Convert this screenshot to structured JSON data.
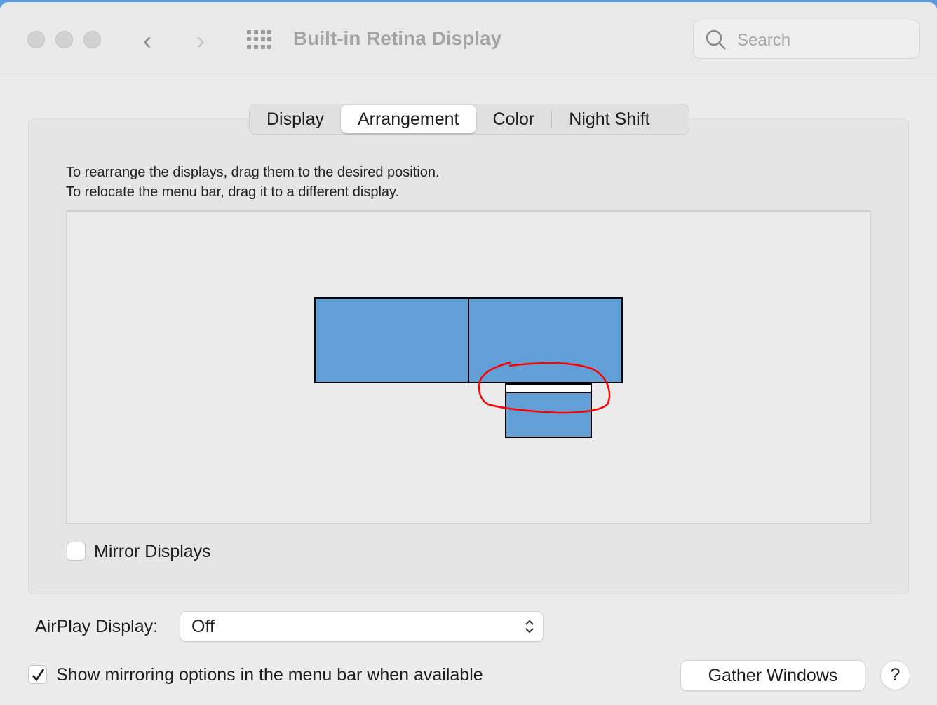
{
  "window": {
    "title": "Built-in Retina Display",
    "search_placeholder": "Search"
  },
  "tabs": [
    {
      "label": "Display"
    },
    {
      "label": "Arrangement",
      "selected": true
    },
    {
      "label": "Color"
    },
    {
      "label": "Night Shift"
    }
  ],
  "arrangement": {
    "instruction_1": "To rearrange the displays, drag them to the desired position.",
    "instruction_2": "To relocate the menu bar, drag it to a different display.",
    "display_color": "#629fd6",
    "annotation_color": "#ff0000"
  },
  "mirror_displays": {
    "label": "Mirror Displays",
    "checked": false
  },
  "airplay": {
    "label": "AirPlay Display:",
    "value": "Off"
  },
  "show_mirroring": {
    "label": "Show mirroring options in the menu bar when available",
    "checked": true
  },
  "buttons": {
    "gather": "Gather Windows",
    "help": "?"
  }
}
